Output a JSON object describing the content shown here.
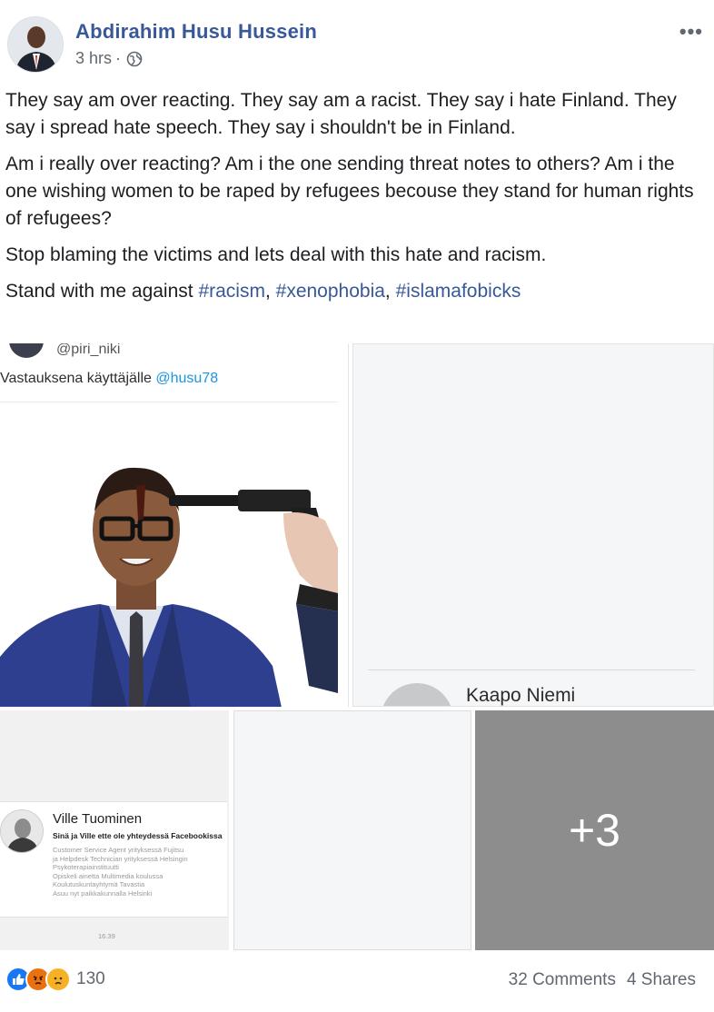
{
  "post": {
    "author": "Abdirahim Husu Hussein",
    "timestamp": "3 hrs",
    "separator": "·",
    "more_label": "•••",
    "paragraphs": [
      "They say am over reacting. They say am a racist. They say i hate Finland. They say i spread hate speech. They say i shouldn't be in Finland.",
      "Am i really over reacting? Am i the one sending threat notes to others? Am i the one wishing women to be raped by refugees becouse they stand for human rights of refugees?",
      "Stop blaming the victims and lets deal with this hate and racism."
    ],
    "hashtag_line": {
      "prefix": "Stand with me against ",
      "tags": [
        "#racism",
        "#xenophobia",
        "#islamafobicks"
      ],
      "sep": ", "
    }
  },
  "photos": {
    "tile1": {
      "handle": "@piri_niki",
      "reply_prefix": "Vastauksena käyttäjälle ",
      "reply_mention": "@husu78"
    },
    "tile2": {
      "profile_name": "Kaapo Niemi"
    },
    "tile3": {
      "name": "Ville Tuominen",
      "subtitle": "Sinä ja Ville ette ole yhteydessä Facebookissa",
      "lines": [
        "Customer Service Agent yrityksessä Fujitsu",
        "ja Helpdesk Technician yrityksessä Helsingin",
        "Psykoterapiainstituutti",
        "Opiskeli ainetta Multimedia koulussa",
        "Koulutuskuntayhtymä Tavastia",
        "Asuu nyt paikkakunnalla Helsinki"
      ],
      "time": "16.39"
    },
    "tile5": {
      "more_count": "+3"
    }
  },
  "footer": {
    "reactions": [
      "like-icon",
      "angry-icon",
      "sad-icon"
    ],
    "reaction_count": "130",
    "comments": "32 Comments",
    "shares": "4 Shares"
  },
  "colors": {
    "link": "#385898",
    "meta": "#606770",
    "like": "#1877f2",
    "angry": "#e9710f",
    "sad": "#f7b125"
  }
}
